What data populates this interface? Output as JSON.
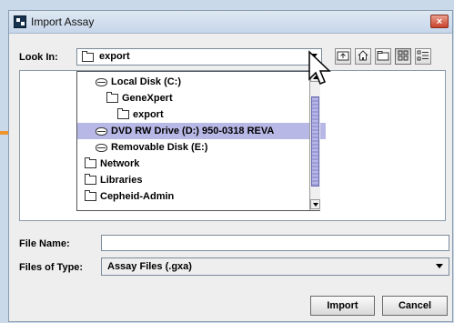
{
  "window": {
    "title": "Import Assay",
    "close_glyph": "×"
  },
  "look_in": {
    "label": "Look In:",
    "value": "export",
    "toolbar_icons": [
      "up-folder-icon",
      "home-icon",
      "new-folder-icon",
      "list-view-icon",
      "details-view-icon"
    ]
  },
  "dropdown": {
    "items": [
      {
        "label": "Local Disk (C:)",
        "icon": "disk-icon"
      },
      {
        "label": "GeneXpert",
        "icon": "folder-icon"
      },
      {
        "label": "export",
        "icon": "folder-icon"
      },
      {
        "label": "DVD RW Drive (D:) 950-0318 REVA",
        "icon": "disk-icon",
        "selected": true
      },
      {
        "label": "Removable Disk (E:)",
        "icon": "disk-icon"
      },
      {
        "label": "Network",
        "icon": "folder-icon"
      },
      {
        "label": "Libraries",
        "icon": "folder-icon"
      },
      {
        "label": "Cepheid-Admin",
        "icon": "folder-icon"
      }
    ]
  },
  "file_name": {
    "label": "File Name:",
    "value": ""
  },
  "file_type": {
    "label": "Files of Type:",
    "value": "Assay Files (.gxa)"
  },
  "buttons": {
    "import": "Import",
    "cancel": "Cancel"
  },
  "colors": {
    "annotation_arrow": "#f0932b",
    "selected_row": "#b8b8e6",
    "close_button": "#c9412a"
  }
}
